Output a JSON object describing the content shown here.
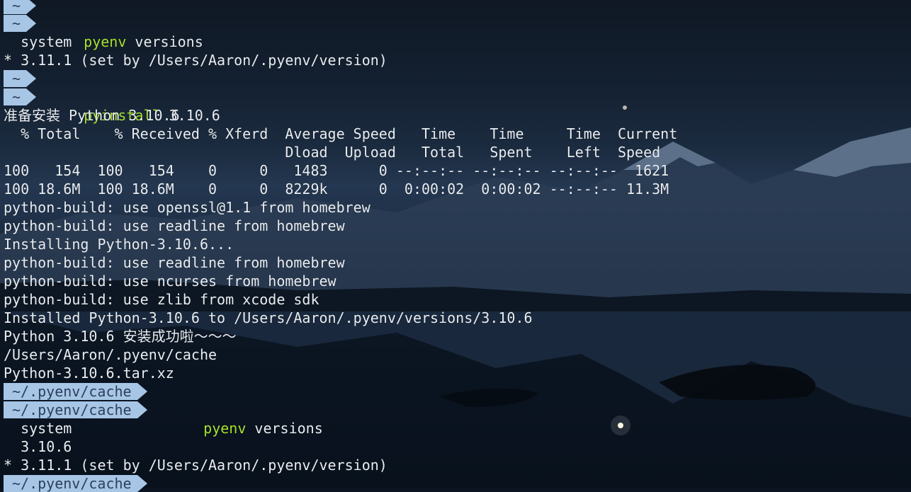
{
  "prompts": {
    "p1_top": "~",
    "p1_bottom": "~",
    "p2_top": "~",
    "p2_bottom": "~",
    "p3_top": "~/.pyenv/cache",
    "p3_bottom": "~/.pyenv/cache",
    "p4_top": "~/.pyenv/cache"
  },
  "commands": {
    "c1_cmd": "pyenv",
    "c1_args": " versions",
    "c2_cmd": "pyinstall",
    "c2_args": " 3.10.6",
    "c3_cmd": "pyenv",
    "c3_args": " versions"
  },
  "output": {
    "o1": "  system",
    "o2": "* 3.11.1 (set by /Users/Aaron/.pyenv/version)",
    "o3": "准备安装 Python 3.10.6",
    "o4": "  % Total    % Received % Xferd  Average Speed   Time    Time     Time  Current",
    "o5": "                                 Dload  Upload   Total   Spent    Left  Speed",
    "o6": "100   154  100   154    0     0   1483      0 --:--:-- --:--:-- --:--:--  1621",
    "o7": "100 18.6M  100 18.6M    0     0  8229k      0  0:00:02  0:00:02 --:--:-- 11.3M",
    "o8": "python-build: use openssl@1.1 from homebrew",
    "o9": "python-build: use readline from homebrew",
    "o10": "Installing Python-3.10.6...",
    "o11": "python-build: use readline from homebrew",
    "o12": "python-build: use ncurses from homebrew",
    "o13": "python-build: use zlib from xcode sdk",
    "o14": "Installed Python-3.10.6 to /Users/Aaron/.pyenv/versions/3.10.6",
    "o15": "Python 3.10.6 安装成功啦～～～",
    "o16": "/Users/Aaron/.pyenv/cache",
    "o17": "Python-3.10.6.tar.xz",
    "o18": "  system",
    "o19": "  3.10.6",
    "o20": "* 3.11.1 (set by /Users/Aaron/.pyenv/version)"
  },
  "colors": {
    "prompt_bg": "#a7c6e6",
    "prompt_fg": "#2b3f5c",
    "command": "#a6e22e",
    "text": "#e9edf2"
  }
}
